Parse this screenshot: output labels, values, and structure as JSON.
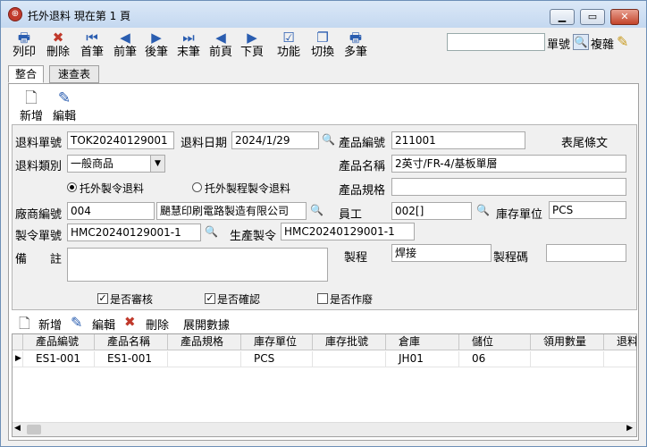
{
  "window": {
    "title": "托外退料  現在第 1 頁"
  },
  "toolbar": [
    {
      "label": "列印",
      "icon": "printer-icon"
    },
    {
      "label": "刪除",
      "icon": "delete-icon"
    },
    {
      "label": "首筆",
      "icon": "first-record-icon"
    },
    {
      "label": "前筆",
      "icon": "prev-record-icon"
    },
    {
      "label": "後筆",
      "icon": "next-record-icon"
    },
    {
      "label": "末筆",
      "icon": "last-record-icon"
    },
    {
      "label": "前頁",
      "icon": "prev-page-icon"
    },
    {
      "label": "下頁",
      "icon": "next-page-icon"
    },
    {
      "label": "功能",
      "icon": "function-icon"
    },
    {
      "label": "切換",
      "icon": "switch-icon"
    },
    {
      "label": "多筆",
      "icon": "multi-record-icon"
    }
  ],
  "search": {
    "label": "單號",
    "copy_label": "複雜",
    "value": ""
  },
  "tabs": [
    "整合",
    "速查表"
  ],
  "subtoolbar": {
    "add": "新增",
    "edit": "編輯"
  },
  "form": {
    "return_no_label": "退料單號",
    "return_no": "TOK20240129001",
    "return_date_label": "退料日期",
    "return_date": "2024/1/29",
    "product_code_label": "產品編號",
    "product_code": "211001",
    "tail_label": "表尾條文",
    "return_type_label": "退料類別",
    "return_type": "一般商品",
    "product_name_label": "產品名稱",
    "product_name": "2英寸/FR-4/基板單層",
    "radio1": "托外製令退料",
    "radio2": "托外製程製令退料",
    "product_spec_label": "產品規格",
    "product_spec": "",
    "vendor_label": "廠商編號",
    "vendor_code": "004",
    "vendor_name": "颶慧印刷電路製造有限公司",
    "staff_label": "員工",
    "staff": "002[]",
    "unit_label": "庫存單位",
    "unit": "PCS",
    "order_label": "製令單號",
    "order_no": "HMC20240129001-1",
    "prod_order_label": "生產製令",
    "prod_order": "HMC20240129001-1",
    "remark_label": "備　　註",
    "remark": "",
    "process_label": "製程",
    "process": "焊接",
    "process_code_label": "製程碼",
    "process_code": "",
    "chk_audit": "是否審核",
    "chk_confirm": "是否確認",
    "chk_void": "是否作廢"
  },
  "detail_toolbar": {
    "add": "新增",
    "edit": "編輯",
    "delete": "刪除",
    "expand": "展開數據"
  },
  "grid": {
    "columns": [
      "產品編號",
      "產品名稱",
      "產品規格",
      "庫存單位",
      "庫存批號",
      "倉庫",
      "儲位",
      "領用數量",
      "退料數"
    ],
    "rows": [
      [
        "ES1-001",
        "ES1-001",
        "",
        "PCS",
        "",
        "JH01",
        "06",
        "",
        ""
      ]
    ]
  }
}
